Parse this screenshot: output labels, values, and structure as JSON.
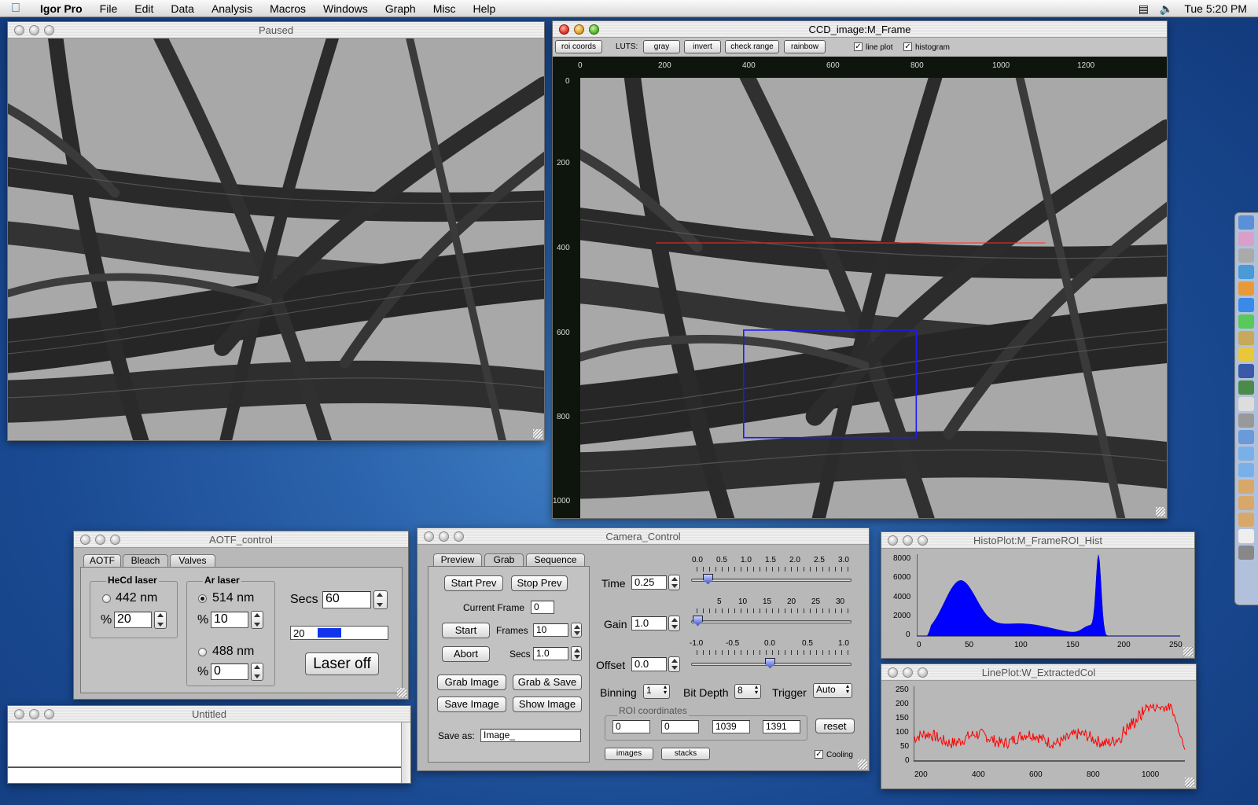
{
  "menubar": {
    "app": "Igor Pro",
    "menus": [
      "File",
      "Edit",
      "Data",
      "Analysis",
      "Macros",
      "Windows",
      "Graph",
      "Misc",
      "Help"
    ],
    "clock": "Tue 5:20 PM"
  },
  "paused_window": {
    "title": "Paused"
  },
  "ccd_window": {
    "title": "CCD_image:M_Frame",
    "roi_coords": "roi coords",
    "luts_label": "LUTS:",
    "gray": "gray",
    "invert": "invert",
    "check_range": "check range",
    "rainbow": "rainbow",
    "line_plot": "line plot",
    "histogram": "histogram",
    "x_ticks": [
      "0",
      "200",
      "400",
      "600",
      "800",
      "1000",
      "1200"
    ],
    "y_ticks": [
      "0",
      "200",
      "400",
      "600",
      "800",
      "1000"
    ]
  },
  "aotf": {
    "title": "AOTF_control",
    "tabs": [
      "AOTF",
      "Bleach",
      "Valves"
    ],
    "hecd_label": "HeCd laser",
    "ar_label": "Ar laser",
    "nm442": "442 nm",
    "nm514": "514 nm",
    "nm488": "488 nm",
    "pct": "%",
    "pct442": "20",
    "pct514": "10",
    "pct488": "0",
    "secs_label": "Secs",
    "secs": "60",
    "progress_value": "20",
    "progress_fraction": 0.25,
    "laser_off": "Laser off"
  },
  "untitled": {
    "title": "Untitled"
  },
  "camera": {
    "title": "Camera_Control",
    "tabs": [
      "Preview",
      "Grab",
      "Sequence"
    ],
    "start_prev": "Start Prev",
    "stop_prev": "Stop Prev",
    "current_frame_label": "Current Frame",
    "current_frame": "0",
    "start": "Start",
    "frames_label": "Frames",
    "frames": "10",
    "abort": "Abort",
    "secs_label": "Secs",
    "secs": "1.0",
    "grab_image": "Grab Image",
    "grab_save": "Grab & Save",
    "save_image": "Save Image",
    "show_image": "Show Image",
    "save_as_label": "Save as:",
    "save_as": "Image_",
    "time_label": "Time",
    "time": "0.25",
    "time_scale": [
      "0.0",
      "0.5",
      "1.0",
      "1.5",
      "2.0",
      "2.5",
      "3.0"
    ],
    "gain_label": "Gain",
    "gain": "1.0",
    "gain_scale": [
      "5",
      "10",
      "15",
      "20",
      "25",
      "30"
    ],
    "offset_label": "Offset",
    "offset": "0.0",
    "offset_scale": [
      "-1.0",
      "-0.5",
      "0.0",
      "0.5",
      "1.0"
    ],
    "binning_label": "Binning",
    "binning": "1",
    "bitdepth_label": "Bit Depth",
    "bitdepth": "8",
    "trigger_label": "Trigger",
    "trigger": "Auto",
    "roi_label": "ROI coordinates",
    "roi": [
      "0",
      "0",
      "1039",
      "1391"
    ],
    "reset": "reset",
    "images": "images",
    "stacks": "stacks",
    "cooling": "Cooling"
  },
  "histo": {
    "title": "HistoPlot:M_FrameROI_Hist",
    "y_ticks": [
      "8000",
      "6000",
      "4000",
      "2000",
      "0"
    ],
    "x_ticks": [
      "0",
      "50",
      "100",
      "150",
      "200",
      "250"
    ],
    "color": "#0000ff"
  },
  "lineplot": {
    "title": "LinePlot:W_ExtractedCol",
    "y_ticks": [
      "250",
      "200",
      "150",
      "100",
      "50",
      "0"
    ],
    "x_ticks": [
      "200",
      "400",
      "600",
      "800",
      "1000"
    ],
    "color": "#ff0000"
  }
}
